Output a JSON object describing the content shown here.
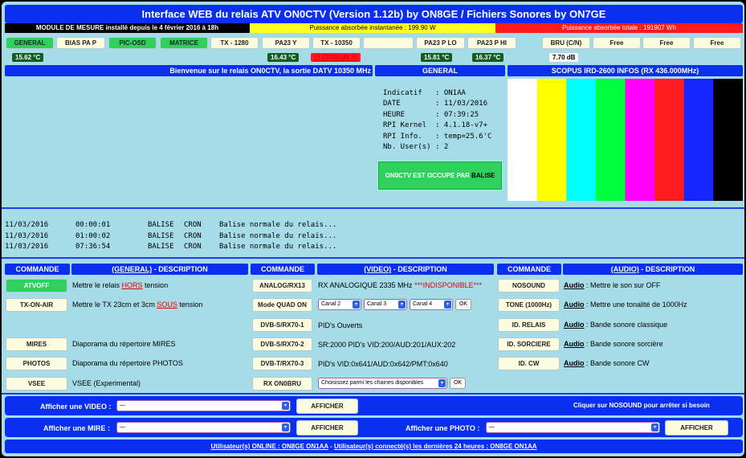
{
  "title": "Interface WEB du relais ATV ON0CTV (Version 1.12b) by ON8GE   /   Fichiers Sonores by ON7GE",
  "status_bar": {
    "module": "MODULE DE MESURE installé depuis le 4 février 2016 à 18h",
    "power_instant": "Puissance absorbée instantanée : 199.90 W",
    "power_total": "Puissance absorbée totale : 191907 Wh"
  },
  "measure_buttons": [
    {
      "label": "GENERAL",
      "active": true
    },
    {
      "label": "BIAS PA P",
      "active": false
    },
    {
      "label": "PIC-OSD",
      "active": true
    },
    {
      "label": "MATRICE",
      "active": true
    },
    {
      "label": "TX - 1280",
      "active": false
    },
    {
      "label": "PA23 Y",
      "active": false
    },
    {
      "label": "TX - 10350",
      "active": false
    },
    {
      "label": "",
      "active": false
    },
    {
      "label": "PA23 P LO",
      "active": false
    },
    {
      "label": "PA23 P HI",
      "active": false
    },
    {
      "label": "BRU (C/N)",
      "active": false
    },
    {
      "label": "Free",
      "active": false
    },
    {
      "label": "Free",
      "active": false
    },
    {
      "label": "Free",
      "active": false
    }
  ],
  "measure_values": {
    "general": "15.62 °C",
    "pa23y": "16.43 °C",
    "tx10350": "!!! ERREUR !!!",
    "pa23plo": "15.81 °C",
    "pa23phi": "16.37 °C",
    "bru": "7.70 dB"
  },
  "welcome": "Bienvenue sur le relais ON0CTV, la sortie DATV 10350 MHz",
  "general": {
    "header": "GENERAL",
    "info": [
      [
        "Indicatif",
        ": ON1AA"
      ],
      [
        "DATE",
        ": 11/03/2016"
      ],
      [
        "HEURE",
        ": 07:39:25"
      ],
      [
        "RPI Kernel",
        ": 4.1.18-v7+"
      ],
      [
        "RPI Info.",
        ": temp=25.6'C"
      ],
      [
        "Nb. User(s)",
        ": 2"
      ]
    ],
    "busy_prefix": "ON0CTV EST OCCUPE PAR",
    "busy_by": "BALISE"
  },
  "scopus": {
    "header": "SCOPUS IRD-2600 INFOS (RX 436.000MHz)",
    "bars": [
      "#ffffff",
      "#ffff00",
      "#00ffff",
      "#00ff3c",
      "#ff00ff",
      "#ff1c1c",
      "#1626ff",
      "#000000"
    ]
  },
  "log": [
    [
      "11/03/2016",
      "00:00:01",
      "BALISE",
      "CRON",
      "Balise normale du relais..."
    ],
    [
      "11/03/2016",
      "01:00:02",
      "BALISE",
      "CRON",
      "Balise normale du relais..."
    ],
    [
      "11/03/2016",
      "07:36:54",
      "BALISE",
      "CRON",
      "Balise normale du relais..."
    ]
  ],
  "table_headers": {
    "commande": "COMMANDE",
    "general_desc_link": "(GENERAL)",
    "general_desc_rest": " - DESCRIPTION",
    "video_desc_link": "(VIDEO)",
    "video_desc_rest": " - DESCRIPTION",
    "audio_desc_link": "(AUDIO)",
    "audio_desc_rest": " - DESCRIPTION"
  },
  "general_cmds": [
    {
      "btn": "ATVOFF",
      "pre": "Mettre le relais ",
      "hl": "HORS",
      "post": " tension",
      "green": true
    },
    {
      "btn": "TX-ON-AIR",
      "pre": "Mettre le TX 23cm et 3cm ",
      "hl": "SOUS",
      "post": " tension",
      "green": false
    },
    {
      "btn": "MIRES",
      "pre": "Diaporama du répertoire MIRES",
      "hl": "",
      "post": "",
      "green": false
    },
    {
      "btn": "PHOTOS",
      "pre": "Diaporama du répertoire PHOTOS",
      "hl": "",
      "post": "",
      "green": false
    },
    {
      "btn": "VSEE",
      "pre": "VSEE (Experimental)",
      "hl": "",
      "post": "",
      "green": false
    }
  ],
  "video_cmds": {
    "analog_btn": "ANALOG/RX13",
    "analog_desc": "RX ANALOGIQUE 2335 MHz",
    "analog_warn": "***INDISPONIBLE***",
    "quad_btn": "Mode QUAD ON",
    "canals": [
      "Canal 2",
      "Canal 3",
      "Canal 4"
    ],
    "ok": "OK",
    "s2_btn": "DVB-S/RX70-1",
    "s2_desc": "PID's Ouverts",
    "s_btn": "DVB-S/RX70-2",
    "s_desc": "SR:2000 PID's VID:200/AUD:201/AUX:202",
    "t_btn": "DVB-T/RX70-3",
    "t_desc": "PID's VID:0x641/AUD:0x642/PMT:0x640",
    "onobru_btn": "RX ON0BRU",
    "onobru_select": "Choisissez parmi les chaines disponibles"
  },
  "audio_cmds": [
    {
      "btn": "NOSOUND",
      "desc": "Mettre le son sur OFF"
    },
    {
      "btn": "TONE (1000Hz)",
      "desc": "Mettre une tonalité de 1000Hz"
    },
    {
      "btn": "ID. RELAIS",
      "desc": "Bande sonore classique"
    },
    {
      "btn": "ID. SORCIERE",
      "desc": "Bande sonore sorcière"
    },
    {
      "btn": "ID. CW",
      "desc": "Bande sonore CW"
    }
  ],
  "audio_label": "Audio",
  "display": {
    "video_label": "Afficher une VIDEO :",
    "mire_label": "Afficher une MIRE :",
    "photo_label": "Afficher une PHOTO :",
    "select_value": "—",
    "afficher": "AFFICHER",
    "nosound_hint": "Cliquer sur NOSOUND pour arrêter si besoin"
  },
  "footer": {
    "online": "Utilisateur(s) ONLINE : ON8GE ON1AA",
    "sep": "-",
    "recent": "Utilisateur(s) connecté(s) les dernières 24 heures : ON8GE ON1AA"
  }
}
